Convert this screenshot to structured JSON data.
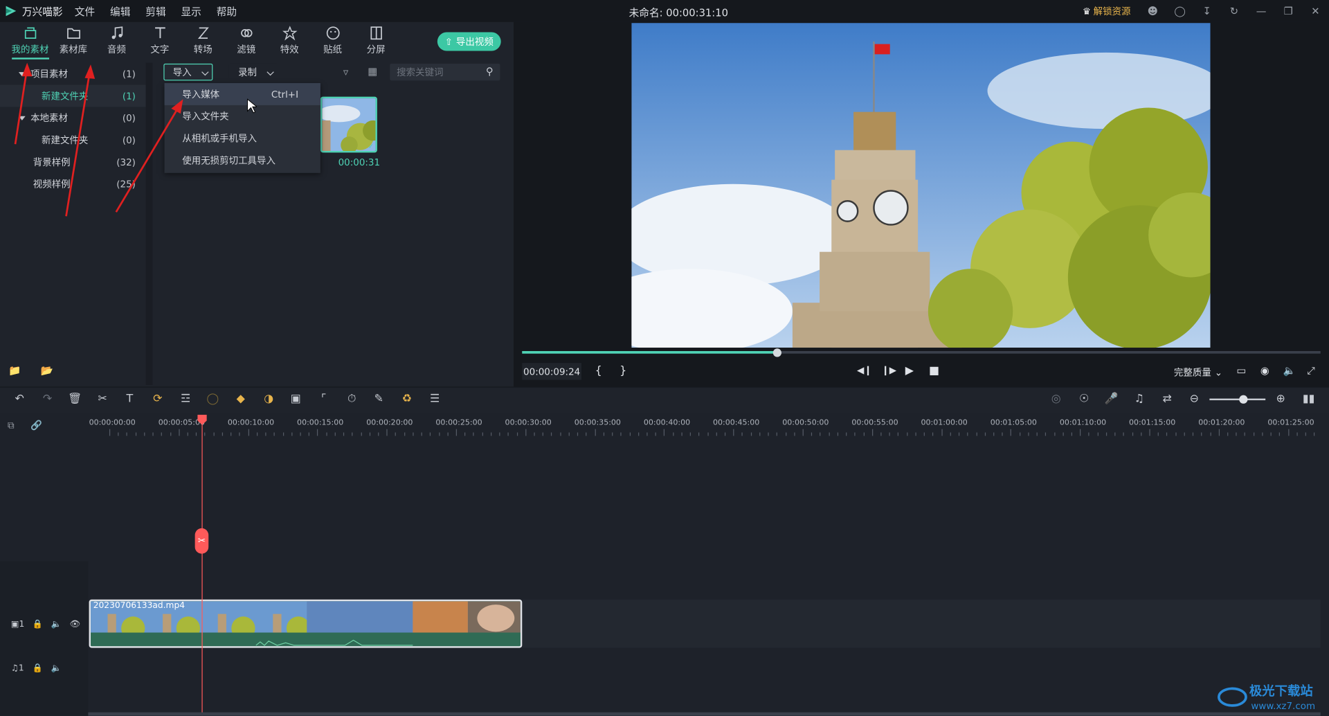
{
  "app": {
    "name": "万兴喵影",
    "title": "未命名: 00:00:31:10",
    "unlock_label": "解锁资源"
  },
  "menu": [
    "文件",
    "编辑",
    "剪辑",
    "显示",
    "帮助"
  ],
  "toolbar": [
    {
      "label": "我的素材",
      "icon": "folder-open-icon",
      "active": true
    },
    {
      "label": "素材库",
      "icon": "folder-icon"
    },
    {
      "label": "音频",
      "icon": "music-note-icon"
    },
    {
      "label": "文字",
      "icon": "text-icon"
    },
    {
      "label": "转场",
      "icon": "transition-icon"
    },
    {
      "label": "滤镜",
      "icon": "filter-icon"
    },
    {
      "label": "特效",
      "icon": "effects-icon"
    },
    {
      "label": "贴纸",
      "icon": "sticker-icon"
    },
    {
      "label": "分屏",
      "icon": "split-screen-icon"
    }
  ],
  "export_label": "导出视频",
  "tree": [
    {
      "label": "项目素材",
      "count": "(1)",
      "expanded": true,
      "indent": 0
    },
    {
      "label": "新建文件夹",
      "count": "(1)",
      "indent": 1,
      "selected": true
    },
    {
      "label": "本地素材",
      "count": "(0)",
      "expanded": true,
      "indent": 0
    },
    {
      "label": "新建文件夹",
      "count": "(0)",
      "indent": 1
    },
    {
      "label": "背景样例",
      "count": "(32)",
      "indent": 0
    },
    {
      "label": "视频样例",
      "count": "(25)",
      "indent": 0
    }
  ],
  "import_dropdown": "导入",
  "record_dropdown": "录制",
  "search_placeholder": "搜索关键词",
  "import_menu": [
    {
      "label": "导入媒体",
      "shortcut": "Ctrl+I",
      "highlighted": true
    },
    {
      "label": "导入文件夹"
    },
    {
      "label": "从相机或手机导入"
    },
    {
      "label": "使用无损剪切工具导入"
    }
  ],
  "media_item": {
    "duration": "00:00:31"
  },
  "preview": {
    "current_time": "00:00:09:24",
    "quality": "完整质量",
    "progress": 0.32
  },
  "ruler": [
    "00:00:00:00",
    "00:00:05:00",
    "00:00:10:00",
    "00:00:15:00",
    "00:00:20:00",
    "00:00:25:00",
    "00:00:30:00",
    "00:00:35:00",
    "00:00:40:00",
    "00:00:45:00",
    "00:00:50:00",
    "00:00:55:00",
    "00:01:00:00",
    "00:01:05:00",
    "00:01:10:00",
    "00:01:15:00",
    "00:01:20:00",
    "00:01:25:00"
  ],
  "clip": {
    "name": "20230706133ad.mp4"
  },
  "tracks": {
    "video": "1",
    "audio": "1"
  },
  "colors": {
    "accent": "#4fd3b5",
    "playhead": "#ff5a5a",
    "annotation": "#e02020"
  }
}
